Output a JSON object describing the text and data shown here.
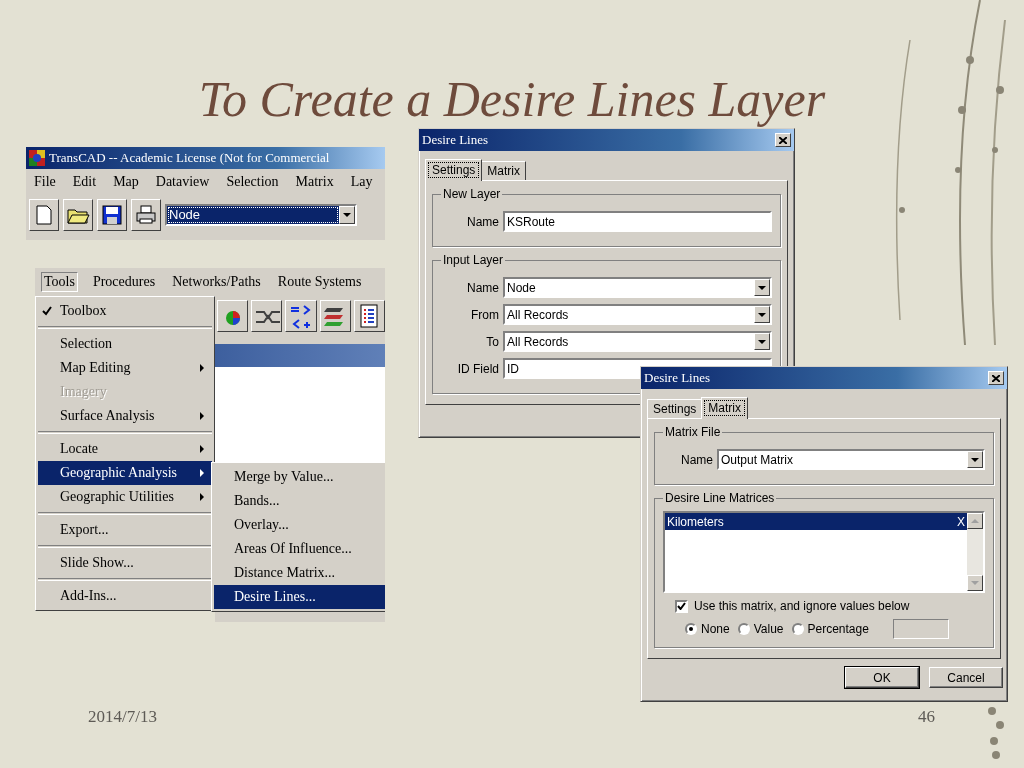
{
  "slide": {
    "title": "To Create a Desire Lines Layer",
    "date": "2014/7/13",
    "page": "46"
  },
  "app_window": {
    "title": "TransCAD -- Academic License (Not for Commercial",
    "menu": [
      "File",
      "Edit",
      "Map",
      "Dataview",
      "Selection",
      "Matrix",
      "Lay"
    ],
    "layer_dropdown": {
      "value": "Node"
    }
  },
  "tools_menu": {
    "menu_bar": [
      {
        "label": "Tools",
        "selected": true
      },
      {
        "label": "Procedures",
        "selected": false
      },
      {
        "label": "Networks/Paths",
        "selected": false
      },
      {
        "label": "Route Systems",
        "selected": false
      }
    ],
    "items": [
      {
        "kind": "item",
        "label": "Toolbox",
        "checked": true,
        "submenu": false,
        "disabled": false,
        "selected": false
      },
      {
        "kind": "separator"
      },
      {
        "kind": "item",
        "label": "Selection",
        "checked": false,
        "submenu": false,
        "disabled": false,
        "selected": false
      },
      {
        "kind": "item",
        "label": "Map Editing",
        "checked": false,
        "submenu": true,
        "disabled": false,
        "selected": false
      },
      {
        "kind": "item",
        "label": "Imagery",
        "checked": false,
        "submenu": false,
        "disabled": true,
        "selected": false
      },
      {
        "kind": "item",
        "label": "Surface Analysis",
        "checked": false,
        "submenu": true,
        "disabled": false,
        "selected": false
      },
      {
        "kind": "separator"
      },
      {
        "kind": "item",
        "label": "Locate",
        "checked": false,
        "submenu": true,
        "disabled": false,
        "selected": false
      },
      {
        "kind": "item",
        "label": "Geographic Analysis",
        "checked": false,
        "submenu": true,
        "disabled": false,
        "selected": true
      },
      {
        "kind": "item",
        "label": "Geographic Utilities",
        "checked": false,
        "submenu": true,
        "disabled": false,
        "selected": false
      },
      {
        "kind": "separator"
      },
      {
        "kind": "item",
        "label": "Export...",
        "checked": false,
        "submenu": false,
        "disabled": false,
        "selected": false
      },
      {
        "kind": "separator"
      },
      {
        "kind": "item",
        "label": "Slide Show...",
        "checked": false,
        "submenu": false,
        "disabled": false,
        "selected": false
      },
      {
        "kind": "separator"
      },
      {
        "kind": "item",
        "label": "Add-Ins...",
        "checked": false,
        "submenu": false,
        "disabled": false,
        "selected": false
      }
    ],
    "submenu": [
      {
        "label": "Merge by Value...",
        "selected": false
      },
      {
        "label": "Bands...",
        "selected": false
      },
      {
        "label": "Overlay...",
        "selected": false
      },
      {
        "label": "Areas Of Influence...",
        "selected": false
      },
      {
        "label": "Distance Matrix...",
        "selected": false
      },
      {
        "label": "Desire Lines...",
        "selected": true
      }
    ]
  },
  "settings_dialog": {
    "title": "Desire Lines",
    "tabs": [
      {
        "label": "Settings",
        "selected": true
      },
      {
        "label": "Matrix",
        "selected": false
      }
    ],
    "groups": [
      {
        "label": "New Layer",
        "fields": [
          {
            "label": "Name",
            "value": "KSRoute",
            "kind": "text"
          }
        ]
      },
      {
        "label": "Input Layer",
        "fields": [
          {
            "label": "Name",
            "value": "Node",
            "kind": "dropdown"
          },
          {
            "label": "From",
            "value": "All Records",
            "kind": "dropdown"
          },
          {
            "label": "To",
            "value": "All Records",
            "kind": "dropdown"
          },
          {
            "label": "ID Field",
            "value": "ID",
            "kind": "text"
          }
        ]
      }
    ]
  },
  "matrix_dialog": {
    "title": "Desire Lines",
    "tabs": [
      {
        "label": "Settings",
        "selected": false
      },
      {
        "label": "Matrix",
        "selected": true
      }
    ],
    "matrix_file": {
      "label": "Matrix File",
      "field_label": "Name",
      "value": "Output Matrix"
    },
    "matrices": {
      "label": "Desire Line Matrices",
      "items": [
        {
          "label": "Kilometers",
          "selected": true,
          "mark": "X"
        }
      ]
    },
    "use_matrix": {
      "label": "Use this matrix, and ignore values below",
      "checked": true
    },
    "ignore_options": [
      {
        "label": "None",
        "selected": true
      },
      {
        "label": "Value",
        "selected": false
      },
      {
        "label": "Percentage",
        "selected": false
      }
    ],
    "buttons": [
      "OK",
      "Cancel"
    ]
  }
}
